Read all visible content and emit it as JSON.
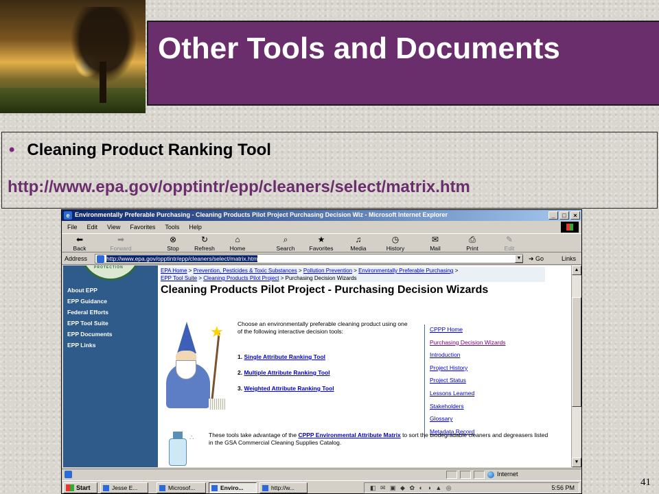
{
  "slide": {
    "title": "Other Tools and Documents",
    "bullet": "Cleaning Product Ranking Tool",
    "url": "http://www.epa.gov/opptintr/epp/cleaners/select/matrix.htm",
    "page_number": "41"
  },
  "browser": {
    "window_title": "Environmentally Preferable Purchasing - Cleaning Products Pilot Project Purchasing Decision Wiz - Microsoft Internet Explorer",
    "menu": [
      "File",
      "Edit",
      "View",
      "Favorites",
      "Tools",
      "Help"
    ],
    "toolbar": {
      "back": "Back",
      "forward": "Forward",
      "stop": "Stop",
      "refresh": "Refresh",
      "home": "Home",
      "search": "Search",
      "favorites": "Favorites",
      "media": "Media",
      "history": "History",
      "mail": "Mail",
      "print": "Print",
      "edit": "Edit"
    },
    "address_label": "Address",
    "address_value": "http://www.epa.gov/opptintr/epp/cleaners/select/matrix.htm",
    "go_label": "Go",
    "links_label": "Links",
    "status_zone": "Internet"
  },
  "webpage": {
    "nav": [
      "About EPP",
      "EPP Guidance",
      "Federal Efforts",
      "EPP Tool Suite",
      "EPP Documents",
      "EPP Links"
    ],
    "seal_text": "PROTECTION",
    "breadcrumb": {
      "epa_home": "EPA Home",
      "prevention": "Prevention, Pesticides & Toxic Substances",
      "pollution": "Pollution Prevention",
      "epp": "Environmentally Preferable Purchasing",
      "tool_suite": "EPP Tool Suite",
      "cpp": "Cleaning Products Pilot Project",
      "current": "Purchasing Decision Wizards",
      "sep": ">"
    },
    "heading": "Cleaning Products Pilot Project - Purchasing Decision Wizards",
    "intro": "Choose an environmentally preferable cleaning product using one of the following interactive decision tools:",
    "tools": [
      {
        "num": "1.",
        "label": "Single Attribute Ranking Tool"
      },
      {
        "num": "2.",
        "label": "Multiple Attribute Ranking Tool"
      },
      {
        "num": "3.",
        "label": "Weighted Attribute Ranking Tool"
      }
    ],
    "right_links": [
      "CPPP Home",
      "Purchasing Decision Wizards",
      "Introduction",
      "Project History",
      "Project Status",
      "Lessons Learned",
      "Stakeholders",
      "Glossary",
      "Metadata Record"
    ],
    "bottom": {
      "before": "These tools take advantage of the",
      "link": "CPPP Environmental Attribute Matrix",
      "after": "to sort the biodegradable cleaners and degreasers listed in the GSA Commercial Cleaning Supplies Catalog."
    }
  },
  "taskbar": {
    "start": "Start",
    "tasks": [
      "Jesse E...",
      "Microsof...",
      "Enviro...",
      "http://w..."
    ],
    "clock": "5:56 PM"
  }
}
